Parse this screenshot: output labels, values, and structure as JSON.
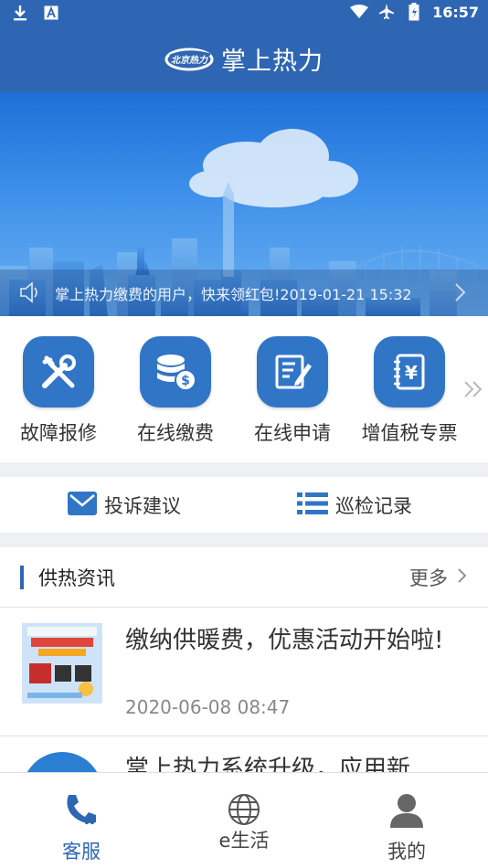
{
  "status_bar": {
    "time": "16:57"
  },
  "header": {
    "title": "掌上热力",
    "logo_text": "北京热力"
  },
  "notice": {
    "text": "掌上热力缴费的用户，快来领红包!2019-01-21 15:32"
  },
  "quick_menu": {
    "items": [
      {
        "label": "故障报修",
        "icon": "tools-icon"
      },
      {
        "label": "在线缴费",
        "icon": "coins-icon"
      },
      {
        "label": "在线申请",
        "icon": "edit-form-icon"
      },
      {
        "label": "增值税专票",
        "icon": "invoice-yen-icon"
      }
    ]
  },
  "secondary_links": [
    {
      "label": "投诉建议",
      "icon": "mail-icon"
    },
    {
      "label": "巡检记录",
      "icon": "list-icon"
    }
  ],
  "news": {
    "section_title": "供热资讯",
    "more_label": "更多",
    "items": [
      {
        "title": "缴纳供暖费，优惠活动开始啦!",
        "date": "2020-06-08 08:47"
      },
      {
        "title": "掌上热力系统升级，应用新"
      }
    ]
  },
  "bottom_nav": {
    "items": [
      {
        "label": "客服",
        "icon": "phone-icon",
        "active": true
      },
      {
        "label": "e生活",
        "icon": "globe-icon",
        "active": false
      },
      {
        "label": "我的",
        "icon": "user-icon",
        "active": false
      }
    ]
  },
  "colors": {
    "brand_blue": "#2f66b3",
    "icon_blue": "#3175c7",
    "active_nav": "#2f66b3",
    "inactive_nav": "#555555"
  }
}
